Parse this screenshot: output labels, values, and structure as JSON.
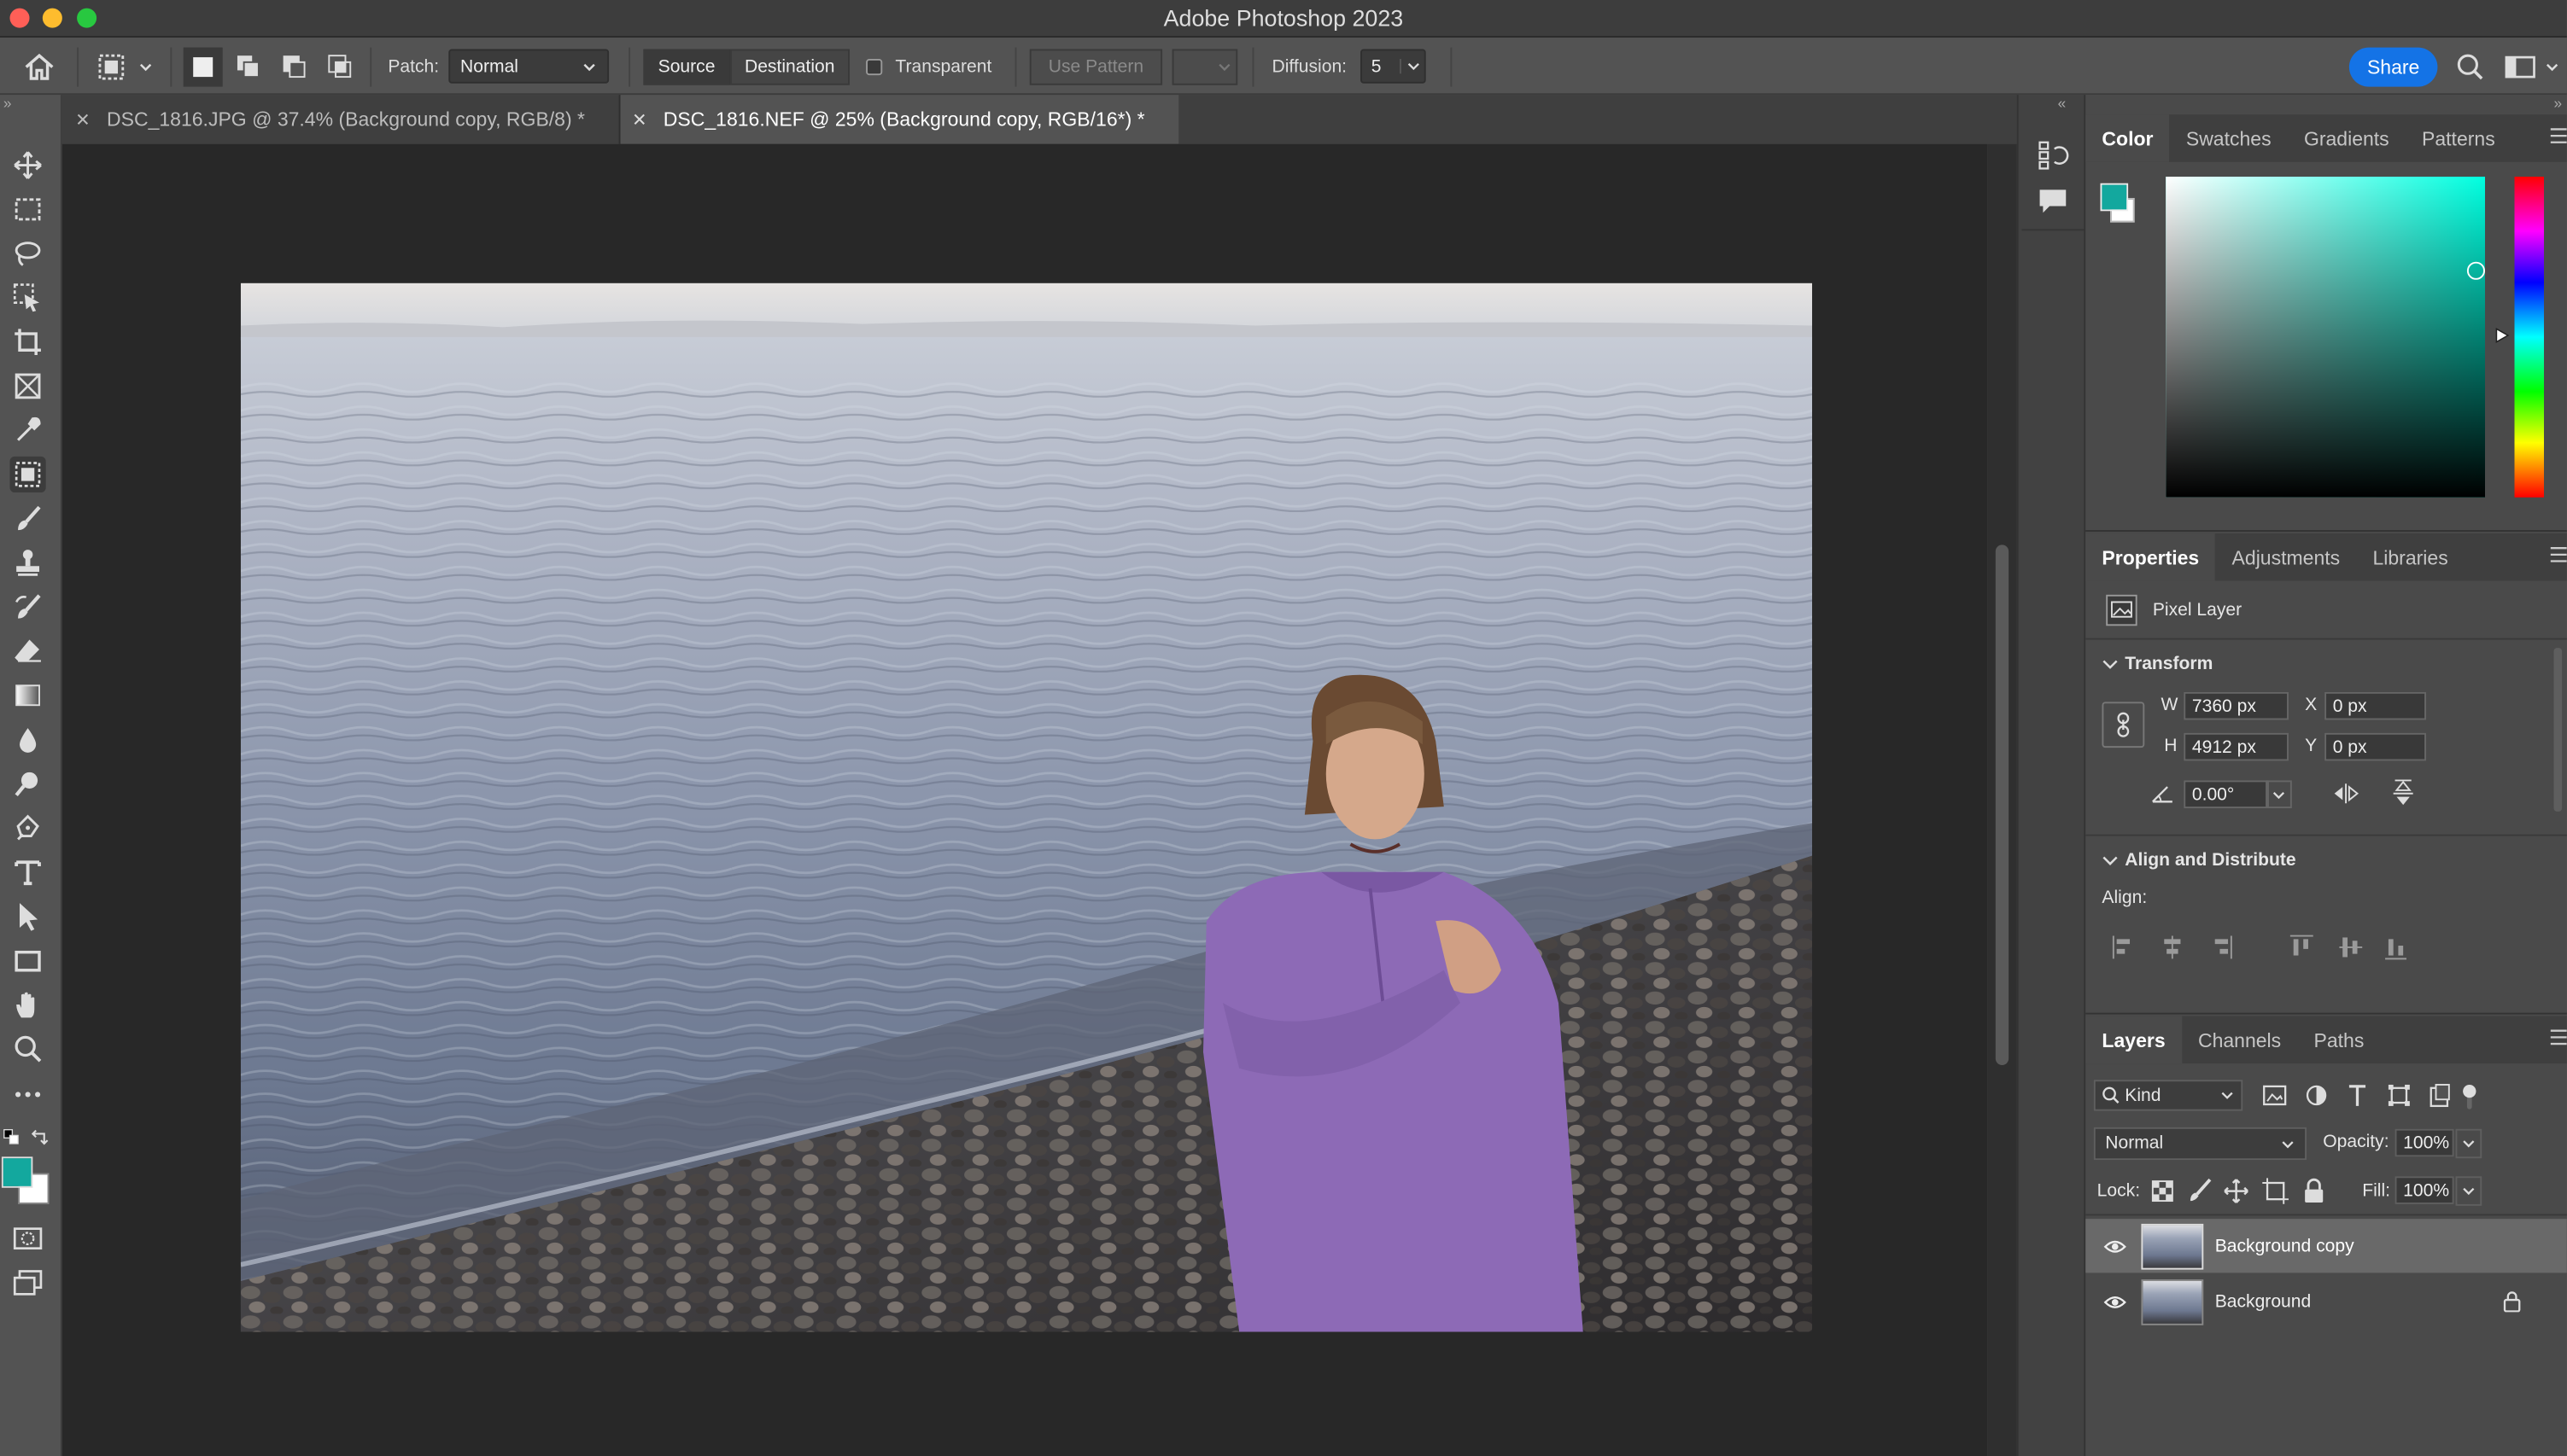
{
  "window": {
    "title": "Adobe Photoshop 2023",
    "traffic_colors": [
      "#ff5f57",
      "#febc2e",
      "#28c840"
    ]
  },
  "options_bar": {
    "patch_label": "Patch:",
    "patch_mode": "Normal",
    "source_label": "Source",
    "destination_label": "Destination",
    "transparent_label": "Transparent",
    "use_pattern_label": "Use Pattern",
    "diffusion_label": "Diffusion:",
    "diffusion_value": "5",
    "share_label": "Share",
    "share_color": "#1473e6"
  },
  "tabs": [
    {
      "label": "DSC_1816.JPG @ 37.4% (Background copy, RGB/8) *",
      "active": false
    },
    {
      "label": "DSC_1816.NEF @ 25% (Background copy, RGB/16*) *",
      "active": true
    }
  ],
  "tools": [
    "move-tool",
    "rectangular-marquee-tool",
    "lasso-tool",
    "object-selection-tool",
    "crop-tool",
    "frame-tool",
    "eyedropper-tool",
    "patch-tool",
    "brush-tool",
    "clone-stamp-tool",
    "history-brush-tool",
    "eraser-tool",
    "gradient-tool",
    "blur-tool",
    "dodge-tool",
    "pen-tool",
    "type-tool",
    "path-selection-tool",
    "rectangle-tool",
    "hand-tool",
    "zoom-tool",
    "edit-toolbar"
  ],
  "colors": {
    "foreground": "#13a89e",
    "background": "#ffffff",
    "picker_hue": "#00ffe0"
  },
  "color_panel": {
    "tabs": [
      "Color",
      "Swatches",
      "Gradients",
      "Patterns"
    ]
  },
  "properties_panel": {
    "tabs": [
      "Properties",
      "Adjustments",
      "Libraries"
    ],
    "layer_type": "Pixel Layer",
    "transform_title": "Transform",
    "w_label": "W",
    "w_value": "7360 px",
    "h_label": "H",
    "h_value": "4912 px",
    "x_label": "X",
    "x_value": "0 px",
    "y_label": "Y",
    "y_value": "0 px",
    "angle_value": "0.00°",
    "align_title": "Align and Distribute",
    "align_label": "Align:"
  },
  "layers_panel": {
    "tabs": [
      "Layers",
      "Channels",
      "Paths"
    ],
    "filter_kind": "Kind",
    "blend_mode": "Normal",
    "opacity_label": "Opacity:",
    "opacity_value": "100%",
    "lock_label": "Lock:",
    "fill_label": "Fill:",
    "fill_value": "100%",
    "layers": [
      {
        "name": "Background copy",
        "selected": true,
        "locked": false,
        "visible": true
      },
      {
        "name": "Background",
        "selected": false,
        "locked": true,
        "visible": true
      }
    ]
  }
}
